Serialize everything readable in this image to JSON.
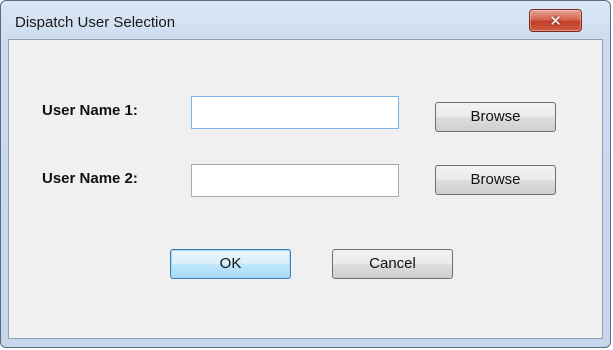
{
  "window": {
    "title": "Dispatch User Selection",
    "close_glyph": "✕"
  },
  "form": {
    "user1_label": "User Name 1:",
    "user1_value": "",
    "user2_label": "User Name 2:",
    "user2_value": "",
    "browse1_label": "Browse",
    "browse2_label": "Browse"
  },
  "actions": {
    "ok_label": "OK",
    "cancel_label": "Cancel"
  },
  "colors": {
    "accent_default_button": "#3c7fb1",
    "close_button": "#c0402a",
    "titlebar": "#cddcee"
  }
}
